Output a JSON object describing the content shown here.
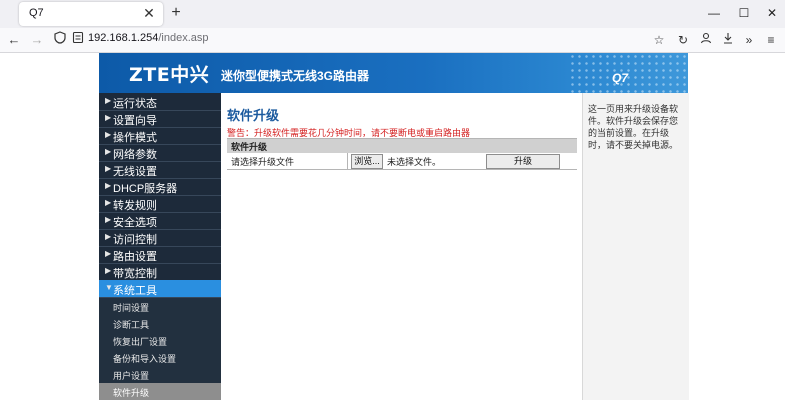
{
  "browser": {
    "tab_title": "Q7",
    "tab_close": "✕",
    "new_tab": "+",
    "url_host": "192.168.1.254",
    "url_path": "/index.asp",
    "window_controls": [
      "—",
      "☐",
      "✕"
    ]
  },
  "banner": {
    "logo": "ZTE中兴",
    "title": "迷你型便携式无线3G路由器",
    "model": "Q7"
  },
  "sidebar": {
    "items": [
      "运行状态",
      "设置向导",
      "操作模式",
      "网络参数",
      "无线设置",
      "DHCP服务器",
      "转发规则",
      "安全选项",
      "访问控制",
      "路由设置",
      "带宽控制",
      "系统工具"
    ],
    "active_index": 11,
    "sub_items": [
      "时间设置",
      "诊断工具",
      "恢复出厂设置",
      "备份和导入设置",
      "用户设置",
      "软件升级"
    ],
    "current_sub_index": 5
  },
  "content": {
    "title": "软件升级",
    "warning": "警告：升级软件需要花几分钟时间，请不要断电或重启路由器",
    "table_header": "软件升级",
    "file_label": "请选择升级文件",
    "browse_button": "浏览...",
    "no_file": "未选择文件。",
    "upgrade_button": "升级"
  },
  "help": {
    "text": "这一页用来升级设备软件。软件升级会保存您的当前设置。在升级时，请不要关掉电源。"
  },
  "colors": {
    "banner": "#1a6fc0",
    "sidebar_bg": "#1d2a3a",
    "menu_active": "#2a8fe0",
    "warning": "#d42020",
    "title": "#1b5a9e"
  }
}
